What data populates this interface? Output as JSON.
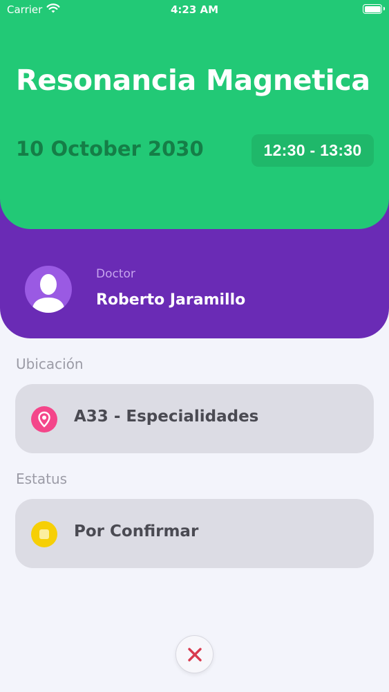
{
  "status_bar": {
    "carrier": "Carrier",
    "time": "4:23 AM",
    "icons": [
      "wifi-icon",
      "battery-icon"
    ]
  },
  "appointment": {
    "title": "Resonancia Magnetica",
    "date": "10 October 2030",
    "time_range": "12:30 - 13:30"
  },
  "doctor": {
    "label": "Doctor",
    "name": "Roberto Jaramillo",
    "avatar_icon": "person-silhouette-icon"
  },
  "location": {
    "label": "Ubicación",
    "value": "A33 - Especialidades",
    "icon": "location-pin-icon"
  },
  "status": {
    "label": "Estatus",
    "value": "Por Confirmar",
    "icon": "pending-status-icon"
  },
  "actions": {
    "close_icon": "close-icon"
  },
  "colors": {
    "header_green": "#22c976",
    "doctor_purple": "#6a2bb5",
    "pin_pink": "#f4468a",
    "status_yellow": "#f6cf06",
    "close_red": "#d83a4e"
  }
}
